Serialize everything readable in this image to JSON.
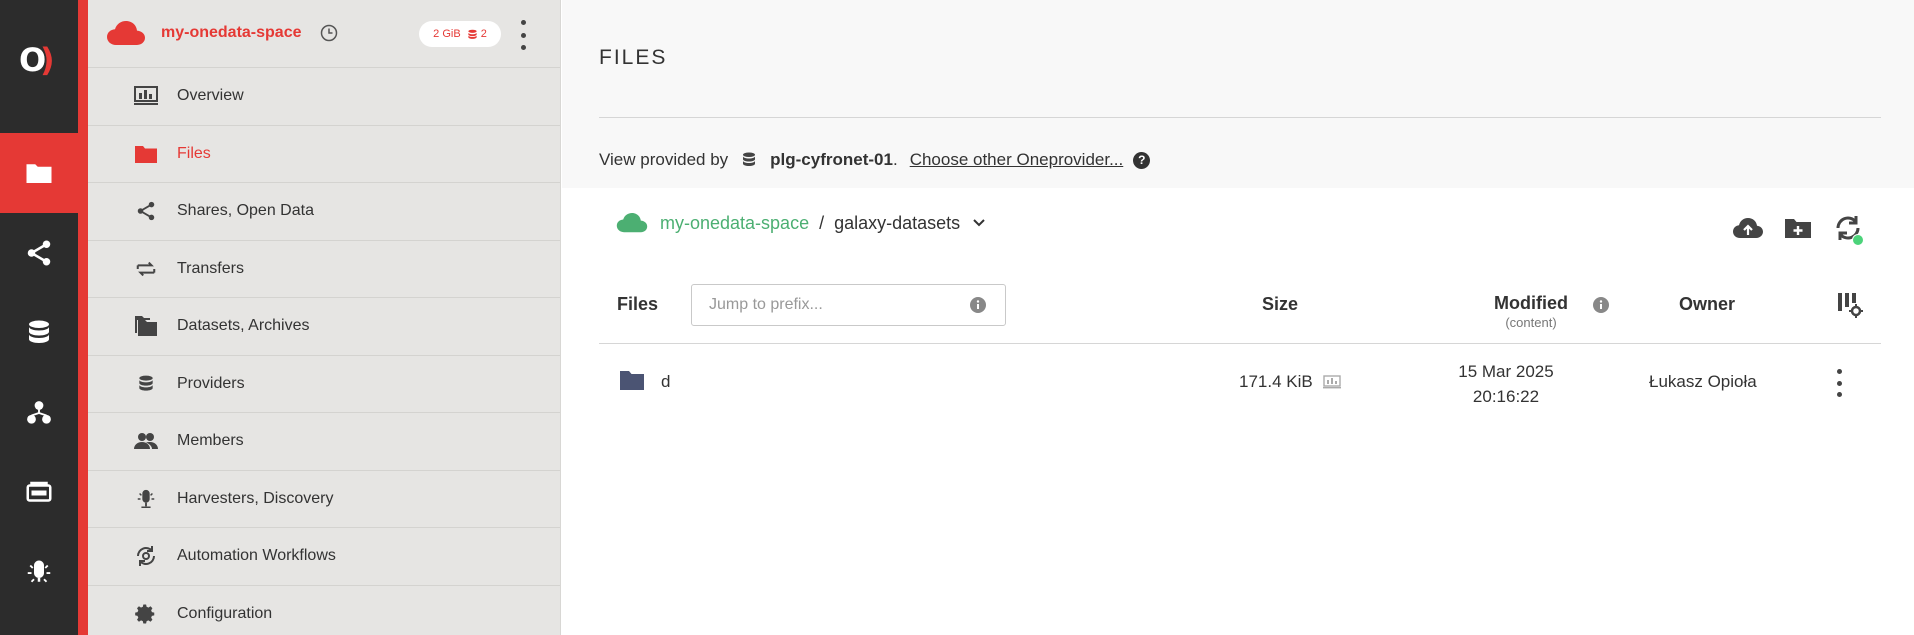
{
  "rail": {
    "logo_left": "O",
    "logo_right": ")",
    "items": [
      {
        "icon": "folder-icon",
        "active": true
      },
      {
        "icon": "share-icon",
        "active": false
      },
      {
        "icon": "database-icon",
        "active": false
      },
      {
        "icon": "groups-icon",
        "active": false
      },
      {
        "icon": "tokens-icon",
        "active": false
      },
      {
        "icon": "harvester-icon",
        "active": false
      }
    ],
    "accent_color": "#e53935"
  },
  "sidebar": {
    "space_name": "my-onedata-space",
    "quota_badge": "2 GiB",
    "providers_badge": "2",
    "items": [
      {
        "label": "Overview",
        "icon": "overview-icon"
      },
      {
        "label": "Files",
        "icon": "folder-icon",
        "active": true
      },
      {
        "label": "Shares, Open Data",
        "icon": "share-icon"
      },
      {
        "label": "Transfers",
        "icon": "transfers-icon"
      },
      {
        "label": "Datasets, Archives",
        "icon": "datasets-icon"
      },
      {
        "label": "Providers",
        "icon": "database-icon"
      },
      {
        "label": "Members",
        "icon": "members-icon"
      },
      {
        "label": "Harvesters, Discovery",
        "icon": "harvester-icon"
      },
      {
        "label": "Automation Workflows",
        "icon": "automation-icon"
      },
      {
        "label": "Configuration",
        "icon": "gear-icon"
      }
    ]
  },
  "main": {
    "title": "FILES",
    "provider_prefix": "View provided by",
    "provider_name": "plg-cyfronet-01",
    "provider_suffix": ".",
    "choose_other": "Choose other Oneprovider...",
    "help": "?",
    "breadcrumb": {
      "space": "my-onedata-space",
      "separator": "/",
      "dir": "galaxy-datasets"
    },
    "table": {
      "col_files": "Files",
      "prefix_placeholder": "Jump to prefix...",
      "col_size": "Size",
      "col_modified": "Modified",
      "col_modified_sub": "(content)",
      "col_owner": "Owner",
      "rows": [
        {
          "name": "d",
          "size": "171.4 KiB",
          "modified_date": "15 Mar 2025",
          "modified_time": "20:16:22",
          "owner": "Łukasz Opioła"
        }
      ]
    },
    "colors": {
      "brand_red": "#e53935",
      "space_green": "#4caf72",
      "status_green": "#4cd37a"
    }
  }
}
